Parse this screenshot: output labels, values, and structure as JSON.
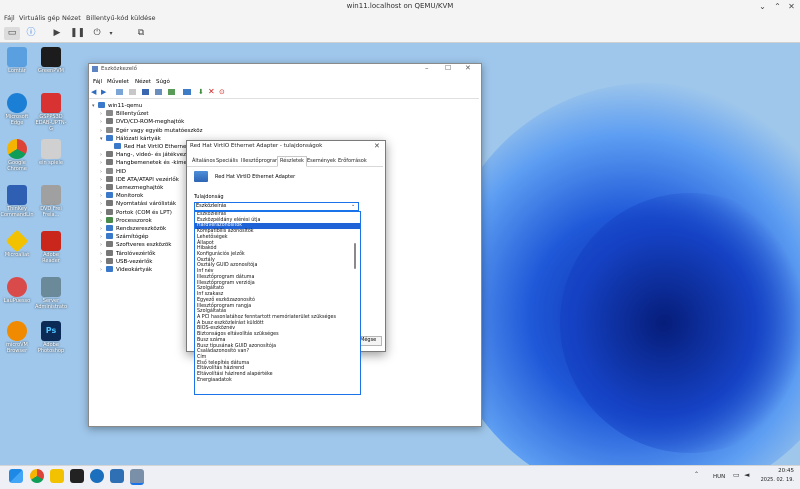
{
  "window": {
    "title": "win11.localhost on QEMU/KVM"
  },
  "menubar": [
    "Fájl",
    "Virtuális gép",
    "Nézet",
    "Billentyű-kód küldése"
  ],
  "desktop_icons": [
    {
      "label": "Lomtár",
      "color": "#5aa0e0"
    },
    {
      "label": "GreenPVM",
      "color": "#1c1c1c"
    },
    {
      "label": "Microsoft Edge",
      "color": "#1c7fd6"
    },
    {
      "label": "GSPPS3D EDAB-UPTN-G",
      "color": "#d93232"
    },
    {
      "label": "Google Chrome",
      "color": "#e8e8e8"
    },
    {
      "label": "ein spiele",
      "color": "#d0d0d0"
    },
    {
      "label": "ThinKey CommandLin",
      "color": "#2f5fb3"
    },
    {
      "label": "DVD Frei Freia...",
      "color": "#a0a0a0"
    },
    {
      "label": "Microaliat",
      "color": "#f2c200"
    },
    {
      "label": "Adobe Reader",
      "color": "#c9271b"
    },
    {
      "label": "LauPuesso",
      "color": "#d94b4b"
    },
    {
      "label": "Server Administrato",
      "color": "#6a8a9a"
    },
    {
      "label": "microVM Browser",
      "color": "#f08a00"
    },
    {
      "label": "Adobe Photoshop",
      "color": "#0b2a56"
    }
  ],
  "device_manager": {
    "title": "Eszközkezelő",
    "menu": [
      "Fájl",
      "Művelet",
      "Nézet",
      "Súgó"
    ],
    "tree": [
      {
        "label": "win11-qemu",
        "level": 0,
        "expand": "▾",
        "color": "#3a78c9"
      },
      {
        "label": "Billentyűzet",
        "level": 1,
        "expand": "›",
        "color": "#888"
      },
      {
        "label": "DVD/CD-ROM-meghajtók",
        "level": 1,
        "expand": "›",
        "color": "#777"
      },
      {
        "label": "Egér vagy egyéb mutatóeszköz",
        "level": 1,
        "expand": "›",
        "color": "#888"
      },
      {
        "label": "Hálózati kártyák",
        "level": 1,
        "expand": "▾",
        "color": "#3a78c9"
      },
      {
        "label": "Red Hat VirtIO Ethernet",
        "level": 2,
        "expand": "",
        "color": "#3a78c9"
      },
      {
        "label": "Hang-, videó- és játékvez",
        "level": 1,
        "expand": "›",
        "color": "#777"
      },
      {
        "label": "Hangbemenetek és -kimen",
        "level": 1,
        "expand": "›",
        "color": "#777"
      },
      {
        "label": "HID",
        "level": 1,
        "expand": "›",
        "color": "#888"
      },
      {
        "label": "IDE ATA/ATAPI vezérlők",
        "level": 1,
        "expand": "›",
        "color": "#777"
      },
      {
        "label": "Lemezmeghajtók",
        "level": 1,
        "expand": "›",
        "color": "#777"
      },
      {
        "label": "Monitorok",
        "level": 1,
        "expand": "›",
        "color": "#3a78c9"
      },
      {
        "label": "Nyomtatási várólisták",
        "level": 1,
        "expand": "›",
        "color": "#777"
      },
      {
        "label": "Portok (COM és LPT)",
        "level": 1,
        "expand": "›",
        "color": "#777"
      },
      {
        "label": "Processzorok",
        "level": 1,
        "expand": "›",
        "color": "#4a8a4a"
      },
      {
        "label": "Rendszereszközök",
        "level": 1,
        "expand": "›",
        "color": "#3a78c9"
      },
      {
        "label": "Számítógép",
        "level": 1,
        "expand": "›",
        "color": "#3a78c9"
      },
      {
        "label": "Szoftveres eszközök",
        "level": 1,
        "expand": "›",
        "color": "#777"
      },
      {
        "label": "Tárolóvezérlők",
        "level": 1,
        "expand": "›",
        "color": "#777"
      },
      {
        "label": "USB-vezérlők",
        "level": 1,
        "expand": "›",
        "color": "#777"
      },
      {
        "label": "Videokártyák",
        "level": 1,
        "expand": "›",
        "color": "#3a78c9"
      }
    ]
  },
  "dialog": {
    "title": "Red Hat VirtIO Ethernet Adapter - tulajdonságok",
    "tabs": [
      "Általános",
      "Speciális",
      "Illesztőprogram",
      "Részletek",
      "Események",
      "Erőforrások"
    ],
    "active_tab": "Részletek",
    "device_name": "Red Hat VirtIO Ethernet Adapter",
    "property_label": "Tulajdonság",
    "property_value": "Eszközleírás",
    "button_label": "Mégse",
    "options": [
      "Eszközleírás",
      "Eszközpéldány elérési útja",
      "Hardverazonosítók",
      "Kompatibilis azonosítók",
      "Lehetőségek",
      "Állapot",
      "Hibakód",
      "Konfigurációs jelzők",
      "Osztály",
      "Osztály GUID azonosítója",
      "Inf név",
      "Illesztőprogram dátuma",
      "Illesztőprogram verziója",
      "Szolgáltató",
      "Inf szakasz",
      "Egyező eszközazonosító",
      "Illesztőprogram rangja",
      "Szolgáltatás",
      "A PCI hasonlatához fenntartott memóriaterület szükséges",
      "A busz eszközleírást küldött",
      "BIOS-eszköznév",
      "Biztonságos eltávolítás szükséges",
      "Busz száma",
      "Busz típusának GUID azonosítója",
      "Családazonosító van?",
      "Cím",
      "Első telepítés dátuma",
      "Eltávolítás házirend",
      "Eltávolítási házirend alapértéke",
      "Energiaadatok"
    ],
    "selected_option": "Hardverazonosítók"
  },
  "taskbar": {
    "language": "HUN",
    "time": "20:45",
    "date": "2025. 02. 19.",
    "icons": [
      "start-icon",
      "chrome-icon",
      "file-explorer-icon",
      "terminal-icon",
      "browser-icon",
      "rdp-icon",
      "device-manager-icon"
    ]
  }
}
